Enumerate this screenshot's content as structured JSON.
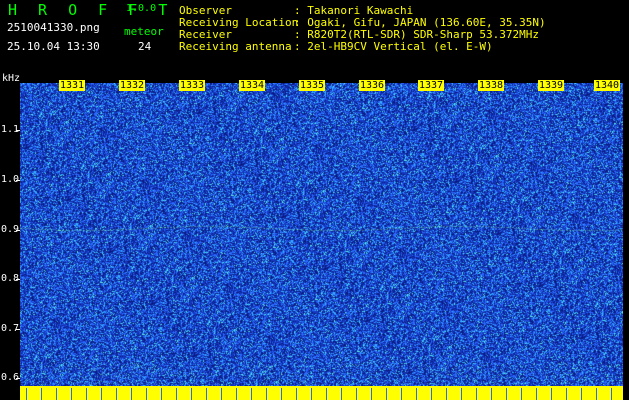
{
  "header": {
    "logo": "H R O F F T",
    "version": "1.0.0",
    "file_name": "2510041330.png",
    "date_time": "25.10.04 13:30",
    "detect_label": "meteor",
    "detect_count": "24"
  },
  "station": [
    {
      "key": "Observer",
      "value": ": Takanori Kawachi"
    },
    {
      "key": "Receiving Location",
      "value": ": Ogaki, Gifu, JAPAN (136.60E, 35.35N)"
    },
    {
      "key": "Receiver",
      "value": ": R820T2(RTL-SDR) SDR-Sharp 53.372MHz"
    },
    {
      "key": "Receiving antenna",
      "value": ": 2el-HB9CV Vertical (el. E-W)"
    }
  ],
  "plot": {
    "unit": "kHz",
    "y_ticks": [
      "1.1",
      "1.0",
      "0.9",
      "0.8",
      "0.7",
      "0.6"
    ],
    "x_ticks": [
      "1331",
      "1332",
      "1333",
      "1334",
      "1335",
      "1336",
      "1337",
      "1338",
      "1339",
      "1340"
    ],
    "colors": {
      "background": "#1538c0",
      "noise_low": "#0a1a80",
      "noise_mid": "#2a6aff",
      "noise_high": "#33e0ff",
      "signal": "#88ff88",
      "floor": "#ffff00"
    }
  }
}
